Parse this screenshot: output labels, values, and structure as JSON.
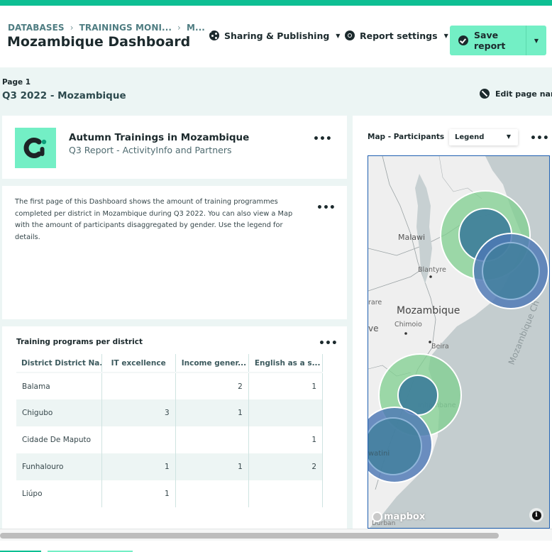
{
  "header": {
    "breadcrumb": [
      "DATABASES",
      "TRAININGS MONI...",
      "M..."
    ],
    "title": "Mozambique Dashboard",
    "sharing_label": "Sharing & Publishing",
    "settings_label": "Report settings",
    "save_label": "Save report"
  },
  "page": {
    "label": "Page 1",
    "name": "Q3 2022 - Mozambique",
    "edit_label": "Edit page name"
  },
  "title_card": {
    "logo_text": "Ci",
    "title": "Autumn Trainings in Mozambique",
    "subtitle": "Q3 Report - ActivityInfo and Partners",
    "menu": "•••"
  },
  "text_card": {
    "body": "The first page of this Dashboard shows the amount of training programmes completed per district in Mozambique during Q3 2022. You can also view a Map with the amount of participants disaggregated by gender. Use the legend for details.",
    "menu": "•••"
  },
  "table_card": {
    "title": "Training programs per district",
    "menu": "•••",
    "columns": [
      "District District Na...",
      "IT excellence",
      "Income gener...",
      "English as a s..."
    ],
    "rows": [
      [
        "Balama",
        "",
        "2",
        "1"
      ],
      [
        "Chigubo",
        "3",
        "1",
        ""
      ],
      [
        "Cidade De Maputo",
        "",
        "",
        "1"
      ],
      [
        "Funhalouro",
        "1",
        "1",
        "2"
      ],
      [
        "Liúpo",
        "1",
        "",
        ""
      ]
    ]
  },
  "map_card": {
    "title": "Map - Participants",
    "legend_label": "Legend",
    "menu": "•••",
    "labels": {
      "malawi": "Malawi",
      "blantyre": "Blantyre",
      "mozambique": "Mozambique",
      "chimoio": "Chimoio",
      "beira": "Beira",
      "inhambane": "Inhambane",
      "harare": "rare",
      "zimbabwe": "ve",
      "eswatini": "watini",
      "channel": "Mozambique Ch",
      "durban": "Durban"
    },
    "attribution": "mapbox",
    "info_icon": "i",
    "colors": {
      "female": "#7fcf8f",
      "male": "#4d78b5",
      "inner": "#3f7f9a"
    }
  },
  "colors": {
    "brand": "#0dbf93",
    "accent": "#73efc5",
    "canvas": "#ecf5f4"
  }
}
